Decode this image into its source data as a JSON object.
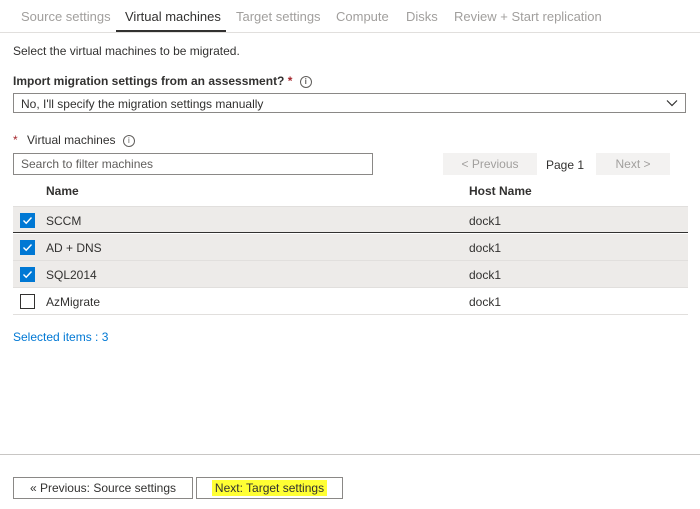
{
  "tabs": [
    {
      "label": "Source settings",
      "active": false
    },
    {
      "label": "Virtual machines",
      "active": true
    },
    {
      "label": "Target settings",
      "active": false
    },
    {
      "label": "Compute",
      "active": false
    },
    {
      "label": "Disks",
      "active": false
    },
    {
      "label": "Review + Start replication",
      "active": false
    }
  ],
  "intro": "Select the virtual machines to be migrated.",
  "import": {
    "label": "Import migration settings from an assessment?",
    "required_mark": "*",
    "info_icon": "info-icon",
    "selected": "No, I'll specify the migration settings manually"
  },
  "vm_section": {
    "required_mark": "*",
    "label": "Virtual machines",
    "info_icon": "info-icon",
    "filter_placeholder": "Search to filter machines"
  },
  "pager": {
    "previous": "< Previous",
    "page": "Page 1",
    "next": "Next >"
  },
  "table": {
    "columns": [
      "Name",
      "Host Name"
    ],
    "rows": [
      {
        "name": "SCCM",
        "host": "dock1",
        "checked": true
      },
      {
        "name": "AD + DNS",
        "host": "dock1",
        "checked": true
      },
      {
        "name": "SQL2014",
        "host": "dock1",
        "checked": true
      },
      {
        "name": "AzMigrate",
        "host": "dock1",
        "checked": false
      }
    ]
  },
  "selected_items": "Selected items : 3",
  "footer": {
    "previous": "« Previous: Source settings",
    "next": "Next: Target settings"
  },
  "colors": {
    "accent": "#0078d4",
    "highlight": "#ffff33",
    "selected_row": "#edebe9"
  }
}
